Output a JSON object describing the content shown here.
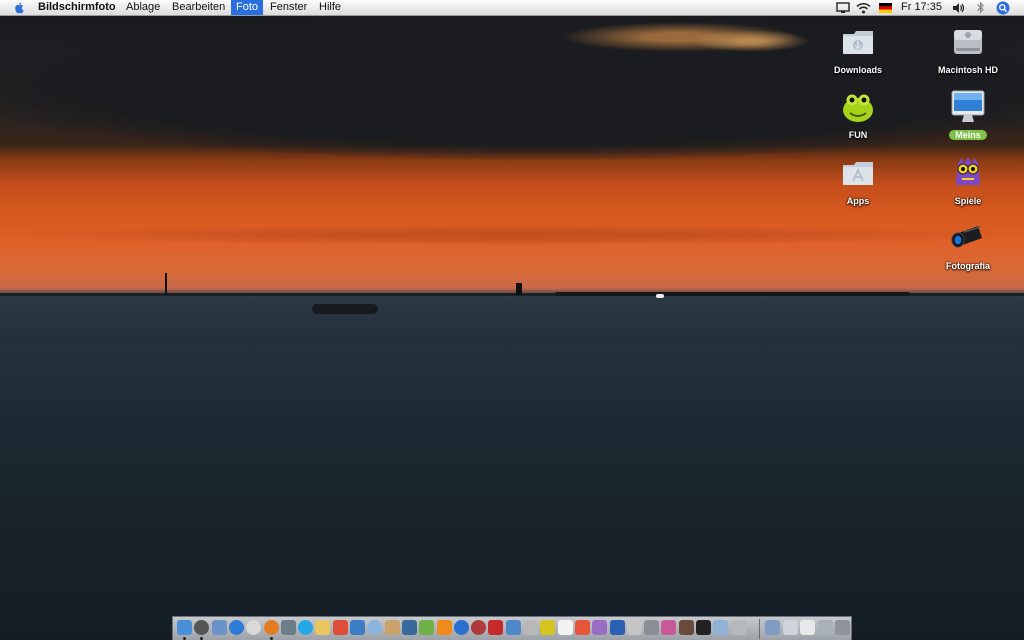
{
  "menubar": {
    "apple_icon": "apple-logo-icon",
    "items": [
      {
        "label": "Bildschirmfoto",
        "app": true
      },
      {
        "label": "Ablage"
      },
      {
        "label": "Bearbeiten"
      },
      {
        "label": "Foto",
        "active": true
      },
      {
        "label": "Fenster"
      },
      {
        "label": "Hilfe"
      }
    ],
    "status": {
      "icons": [
        "display-mirroring-icon",
        "wifi-icon",
        "german-flag-icon",
        "volume-icon",
        "bluetooth-icon",
        "spotlight-icon"
      ],
      "clock": "Fr 17:35"
    }
  },
  "desktop_icons": [
    {
      "label": "Downloads",
      "icon": "downloads-folder-icon",
      "selected": false
    },
    {
      "label": "Macintosh HD",
      "icon": "hard-drive-icon",
      "selected": false
    },
    {
      "label": "FUN",
      "icon": "frog-icon",
      "selected": false
    },
    {
      "label": "Meins",
      "icon": "imac-icon",
      "selected": true
    },
    {
      "label": "Apps",
      "icon": "apps-folder-icon",
      "selected": false
    },
    {
      "label": "Spiele",
      "icon": "purple-monster-icon",
      "selected": false
    },
    {
      "label": "Fotografia",
      "icon": "camera-lens-icon",
      "selected": false
    }
  ],
  "dock": {
    "apps": [
      "finder-icon",
      "dashboard-icon",
      "preview-icon",
      "safari-icon",
      "itunes-icon",
      "firefox-icon",
      "lock-icon",
      "skype-icon",
      "notes-icon",
      "ical-icon",
      "iphoto-icon",
      "mail-icon",
      "address-book-icon",
      "pen-icon",
      "coda-icon",
      "vlc-icon",
      "globe-icon",
      "photo-booth-icon",
      "red-app-icon",
      "finder-app-icon",
      "guitar-icon",
      "yahoo-icon",
      "textedit-icon",
      "paint-icon",
      "tool-icon",
      "photoshop-icon",
      "mirror-icon",
      "system-preferences-icon",
      "theme-icon",
      "photo-icon",
      "terminal-icon",
      "activity-monitor-icon",
      "disk-utility-icon"
    ],
    "others": [
      "applications-stack-icon",
      "downloads-stack-icon",
      "documents-stack-icon",
      "network-stack-icon",
      "trash-icon"
    ]
  }
}
